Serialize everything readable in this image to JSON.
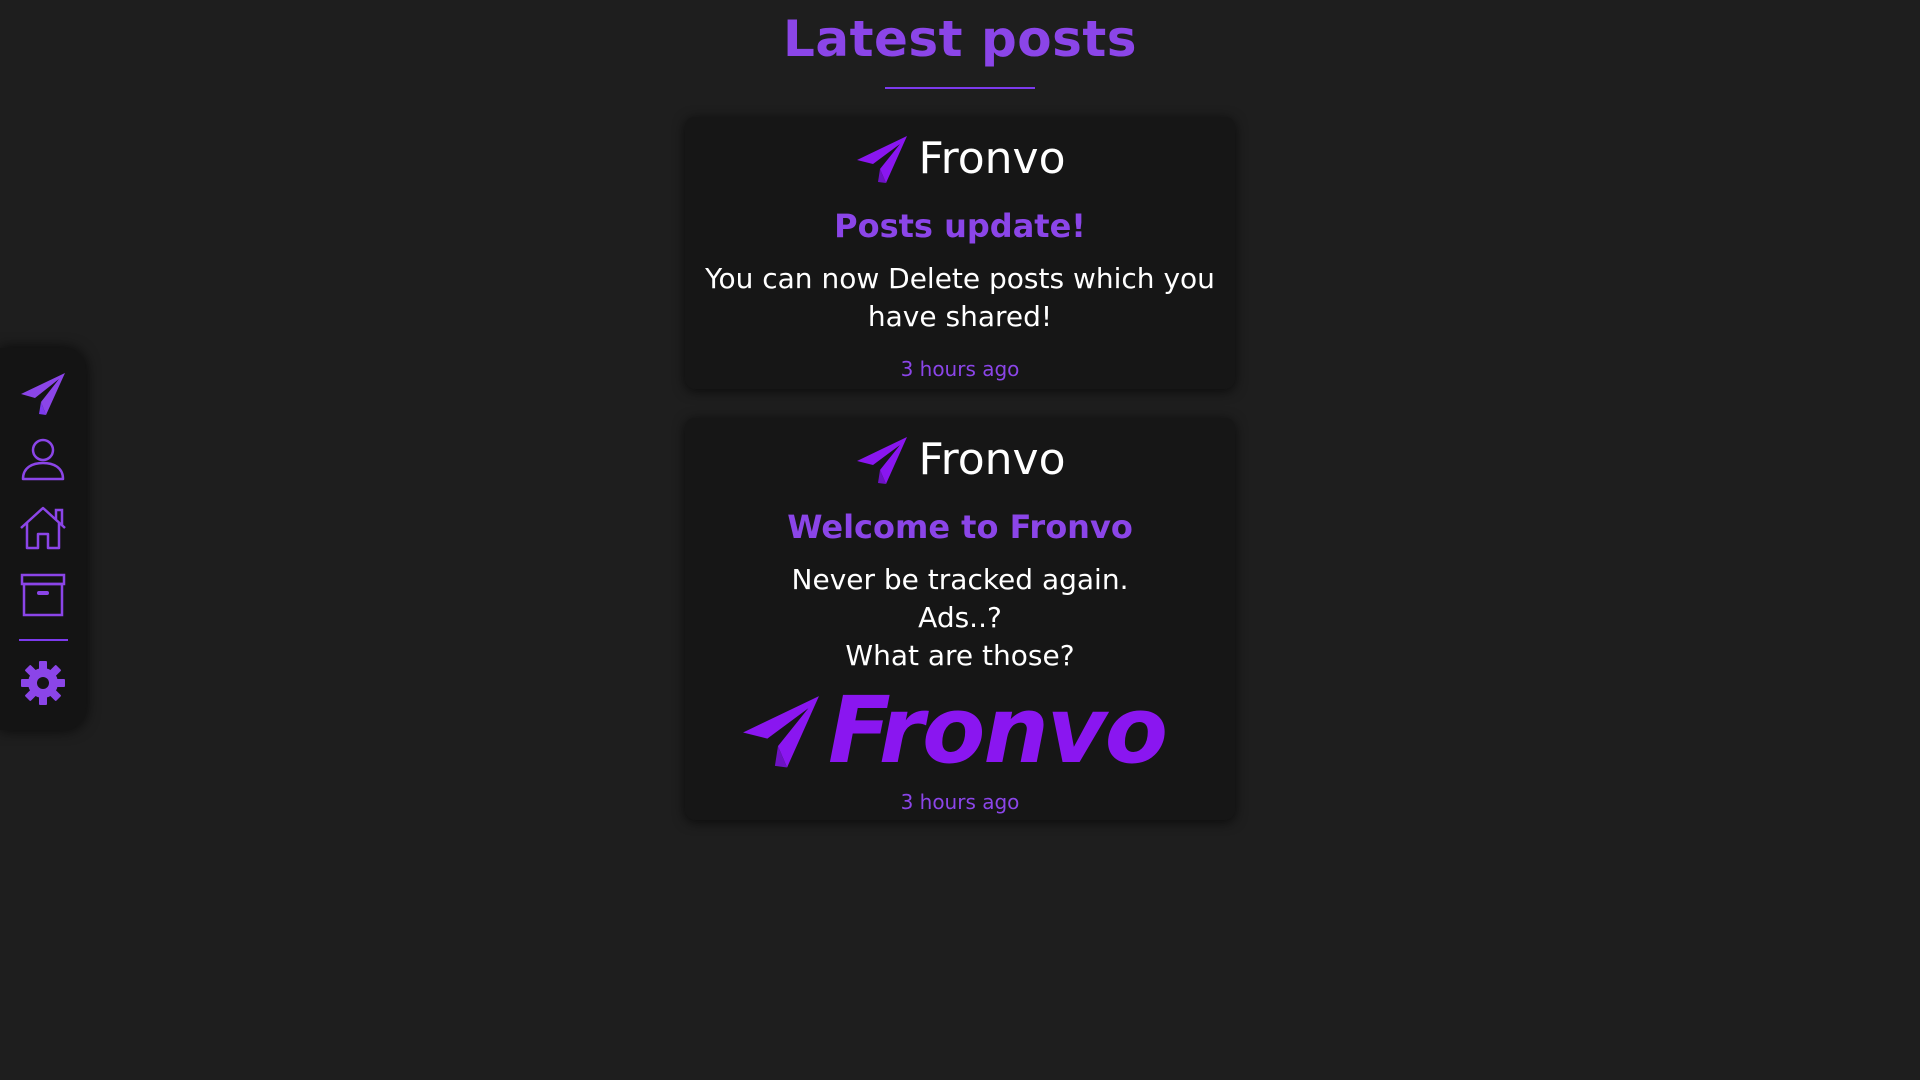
{
  "page": {
    "title": "Latest posts"
  },
  "colors": {
    "background": "#1e1e1e",
    "card": "#161616",
    "accent": "#8b45e8",
    "logo": "#8a16f0"
  },
  "sidebar": {
    "items": [
      {
        "name": "logo",
        "icon": "paper-plane-icon"
      },
      {
        "name": "profile",
        "icon": "user-icon"
      },
      {
        "name": "home",
        "icon": "house-icon"
      },
      {
        "name": "archive",
        "icon": "archive-box-icon"
      },
      {
        "name": "settings",
        "icon": "gear-icon"
      }
    ]
  },
  "posts": [
    {
      "brand": "Fronvo",
      "title": "Posts update!",
      "body_lines": [
        "You can now Delete posts which you",
        "have shared!"
      ],
      "time": "3 hours ago"
    },
    {
      "brand": "Fronvo",
      "title": "Welcome to Fronvo",
      "body_lines": [
        "Never be tracked again.",
        "Ads..?",
        "What are those?"
      ],
      "logo_text": "Fronvo",
      "time": "3 hours ago"
    }
  ]
}
